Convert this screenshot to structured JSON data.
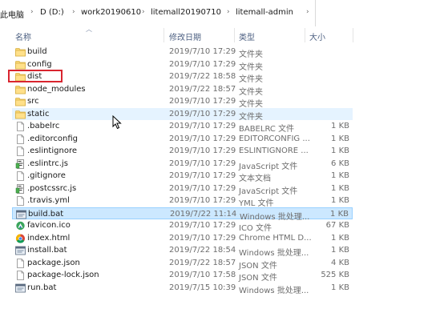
{
  "breadcrumb": {
    "items": [
      "此电脑",
      "D (D:)",
      "work20190610",
      "litemall20190710",
      "litemall-admin"
    ]
  },
  "columns": {
    "name": "名称",
    "date": "修改日期",
    "type": "类型",
    "size": "大小"
  },
  "rows": [
    {
      "name": "build",
      "date": "2019/7/10 17:29",
      "type": "文件夹",
      "size": "",
      "icon": "folder-icon"
    },
    {
      "name": "config",
      "date": "2019/7/10 17:29",
      "type": "文件夹",
      "size": "",
      "icon": "folder-icon"
    },
    {
      "name": "dist",
      "date": "2019/7/22 18:58",
      "type": "文件夹",
      "size": "",
      "icon": "folder-icon"
    },
    {
      "name": "node_modules",
      "date": "2019/7/22 18:57",
      "type": "文件夹",
      "size": "",
      "icon": "folder-icon"
    },
    {
      "name": "src",
      "date": "2019/7/10 17:29",
      "type": "文件夹",
      "size": "",
      "icon": "folder-icon"
    },
    {
      "name": "static",
      "date": "2019/7/10 17:29",
      "type": "文件夹",
      "size": "",
      "icon": "folder-icon"
    },
    {
      "name": ".babelrc",
      "date": "2019/7/10 17:29",
      "type": "BABELRC 文件",
      "size": "1 KB",
      "icon": "file-icon"
    },
    {
      "name": ".editorconfig",
      "date": "2019/7/10 17:29",
      "type": "EDITORCONFIG ...",
      "size": "1 KB",
      "icon": "file-icon"
    },
    {
      "name": ".eslintignore",
      "date": "2019/7/10 17:29",
      "type": "ESLINTIGNORE ...",
      "size": "1 KB",
      "icon": "file-icon"
    },
    {
      "name": ".eslintrc.js",
      "date": "2019/7/10 17:29",
      "type": "JavaScript 文件",
      "size": "6 KB",
      "icon": "script-icon"
    },
    {
      "name": ".gitignore",
      "date": "2019/7/10 17:29",
      "type": "文本文档",
      "size": "1 KB",
      "icon": "file-icon"
    },
    {
      "name": ".postcssrc.js",
      "date": "2019/7/10 17:29",
      "type": "JavaScript 文件",
      "size": "1 KB",
      "icon": "script-icon"
    },
    {
      "name": ".travis.yml",
      "date": "2019/7/10 17:29",
      "type": "YML 文件",
      "size": "1 KB",
      "icon": "file-icon"
    },
    {
      "name": "build.bat",
      "date": "2019/7/22 11:14",
      "type": "Windows 批处理...",
      "size": "1 KB",
      "icon": "bat-icon"
    },
    {
      "name": "favicon.ico",
      "date": "2019/7/10 17:29",
      "type": "ICO 文件",
      "size": "67 KB",
      "icon": "ico-icon"
    },
    {
      "name": "index.html",
      "date": "2019/7/10 17:29",
      "type": "Chrome HTML D...",
      "size": "1 KB",
      "icon": "chrome-icon"
    },
    {
      "name": "install.bat",
      "date": "2019/7/22 18:54",
      "type": "Windows 批处理...",
      "size": "1 KB",
      "icon": "bat-icon"
    },
    {
      "name": "package.json",
      "date": "2019/7/22 18:57",
      "type": "JSON 文件",
      "size": "4 KB",
      "icon": "file-icon"
    },
    {
      "name": "package-lock.json",
      "date": "2019/7/10 17:58",
      "type": "JSON 文件",
      "size": "525 KB",
      "icon": "file-icon"
    },
    {
      "name": "run.bat",
      "date": "2019/7/15 10:39",
      "type": "Windows 批处理...",
      "size": "1 KB",
      "icon": "bat-icon"
    }
  ],
  "hovered_row": "static",
  "selected_row": "build.bat",
  "highlight_color": "#d9252f"
}
